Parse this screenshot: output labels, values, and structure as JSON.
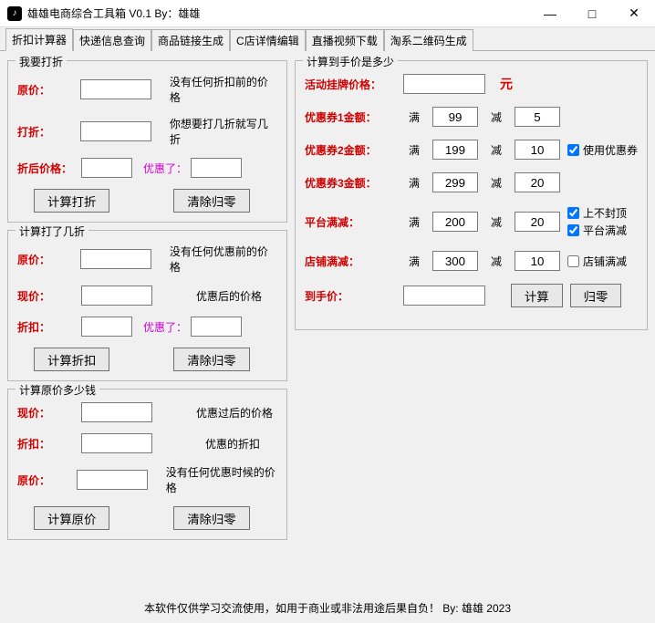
{
  "window": {
    "title": "雄雄电商综合工具箱 V0.1    By：雄雄"
  },
  "tabs": [
    "折扣计算器",
    "快递信息查询",
    "商品链接生成",
    "C店详情编辑",
    "直播视频下载",
    "淘系二维码生成"
  ],
  "group1": {
    "legend": "我要打折",
    "r1_label": "原价：",
    "r1_desc": "没有任何折扣前的价格",
    "r2_label": "打折：",
    "r2_desc": "你想要打几折就写几折",
    "r3_label": "折后价格：",
    "r3_promo": "优惠了：",
    "btn_calc": "计算打折",
    "btn_clear": "清除归零"
  },
  "group2": {
    "legend": "计算打了几折",
    "r1_label": "原价：",
    "r1_desc": "没有任何优惠前的价格",
    "r2_label": "现价：",
    "r2_desc": "优惠后的价格",
    "r3_label": "折扣：",
    "r3_promo": "优惠了：",
    "btn_calc": "计算折扣",
    "btn_clear": "清除归零"
  },
  "group3": {
    "legend": "计算原价多少钱",
    "r1_label": "现价：",
    "r1_desc": "优惠过后的价格",
    "r2_label": "折扣：",
    "r2_desc": "优惠的折扣",
    "r3_label": "原价：",
    "r3_desc": "没有任何优惠时候的价格",
    "btn_calc": "计算原价",
    "btn_clear": "清除归零"
  },
  "group4": {
    "legend": "计算到手价是多少",
    "price_label": "活动挂牌价格：",
    "unit": "元",
    "c1_label": "优惠券1金额：",
    "c2_label": "优惠券2金额：",
    "c3_label": "优惠券3金额：",
    "plat_label": "平台满减：",
    "shop_label": "店铺满减：",
    "final_label": "到手价：",
    "man": "满",
    "jian": "减",
    "c1_man": "99",
    "c1_jian": "5",
    "c2_man": "199",
    "c2_jian": "10",
    "c3_man": "299",
    "c3_jian": "20",
    "pm_man": "200",
    "pm_jian": "20",
    "sm_man": "300",
    "sm_jian": "10",
    "cb_use_coupon": "使用优惠券",
    "cb_no_cap": "上不封顶",
    "cb_plat": "平台满减",
    "cb_shop": "店铺满减",
    "btn_calc": "计算",
    "btn_clear": "归零"
  },
  "footer": "本软件仅供学习交流使用，如用于商业或非法用途后果自负！ By: 雄雄  2023"
}
